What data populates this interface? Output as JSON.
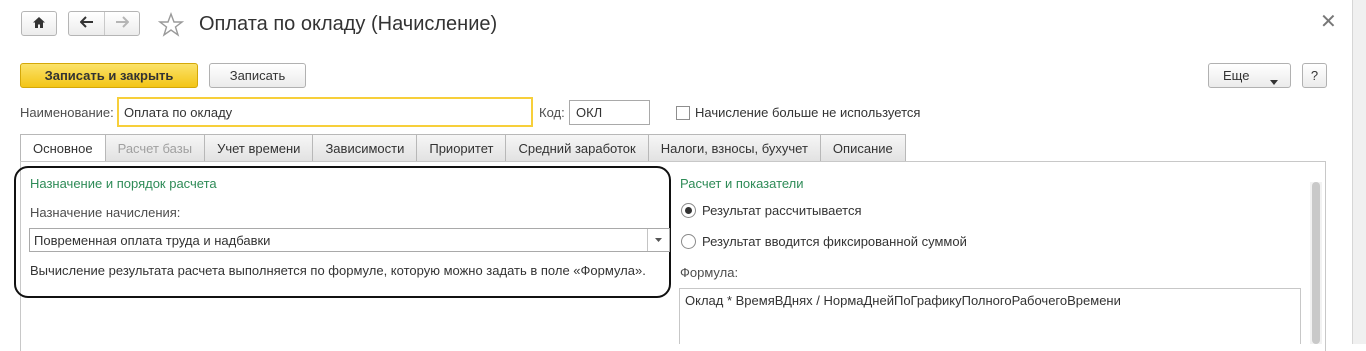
{
  "window": {
    "title": "Оплата по окладу (Начисление)",
    "icons": {
      "home": "home-icon",
      "back": "back-arrow-icon",
      "forward": "forward-arrow-icon",
      "favorite": "star-icon",
      "close": "close-icon"
    }
  },
  "toolbar": {
    "save_close_label": "Записать и закрыть",
    "save_label": "Записать",
    "more_label": "Еще",
    "help_label": "?"
  },
  "header": {
    "name_label": "Наименование:",
    "name_value": "Оплата по окладу",
    "code_label": "Код:",
    "code_value": "ОКЛ",
    "unused_label": "Начисление больше не используется",
    "unused_checked": false
  },
  "tabs": [
    {
      "label": "Основное",
      "active": true,
      "disabled": false
    },
    {
      "label": "Расчет базы",
      "active": false,
      "disabled": true
    },
    {
      "label": "Учет времени",
      "active": false,
      "disabled": false
    },
    {
      "label": "Зависимости",
      "active": false,
      "disabled": false
    },
    {
      "label": "Приоритет",
      "active": false,
      "disabled": false
    },
    {
      "label": "Средний заработок",
      "active": false,
      "disabled": false
    },
    {
      "label": "Налоги, взносы, бухучет",
      "active": false,
      "disabled": false
    },
    {
      "label": "Описание",
      "active": false,
      "disabled": false
    }
  ],
  "left_group": {
    "title": "Назначение и порядок расчета",
    "purpose_label": "Назначение начисления:",
    "purpose_value": "Повременная оплата труда и надбавки",
    "hint": "Вычисление результата расчета выполняется по формуле, которую можно задать в поле «Формула»."
  },
  "right_group": {
    "title": "Расчет и показатели",
    "radio_calculated": "Результат рассчитывается",
    "radio_fixed": "Результат вводится фиксированной суммой",
    "selected_radio": "calculated",
    "formula_label": "Формула:",
    "formula_value": "Оклад * ВремяВДнях / НормаДнейПоГрафикуПолногоРабочегоВремени"
  },
  "colors": {
    "accent_yellow": "#f3c516",
    "group_title_green": "#2e8b57",
    "focus_border": "#f7cf3a"
  }
}
